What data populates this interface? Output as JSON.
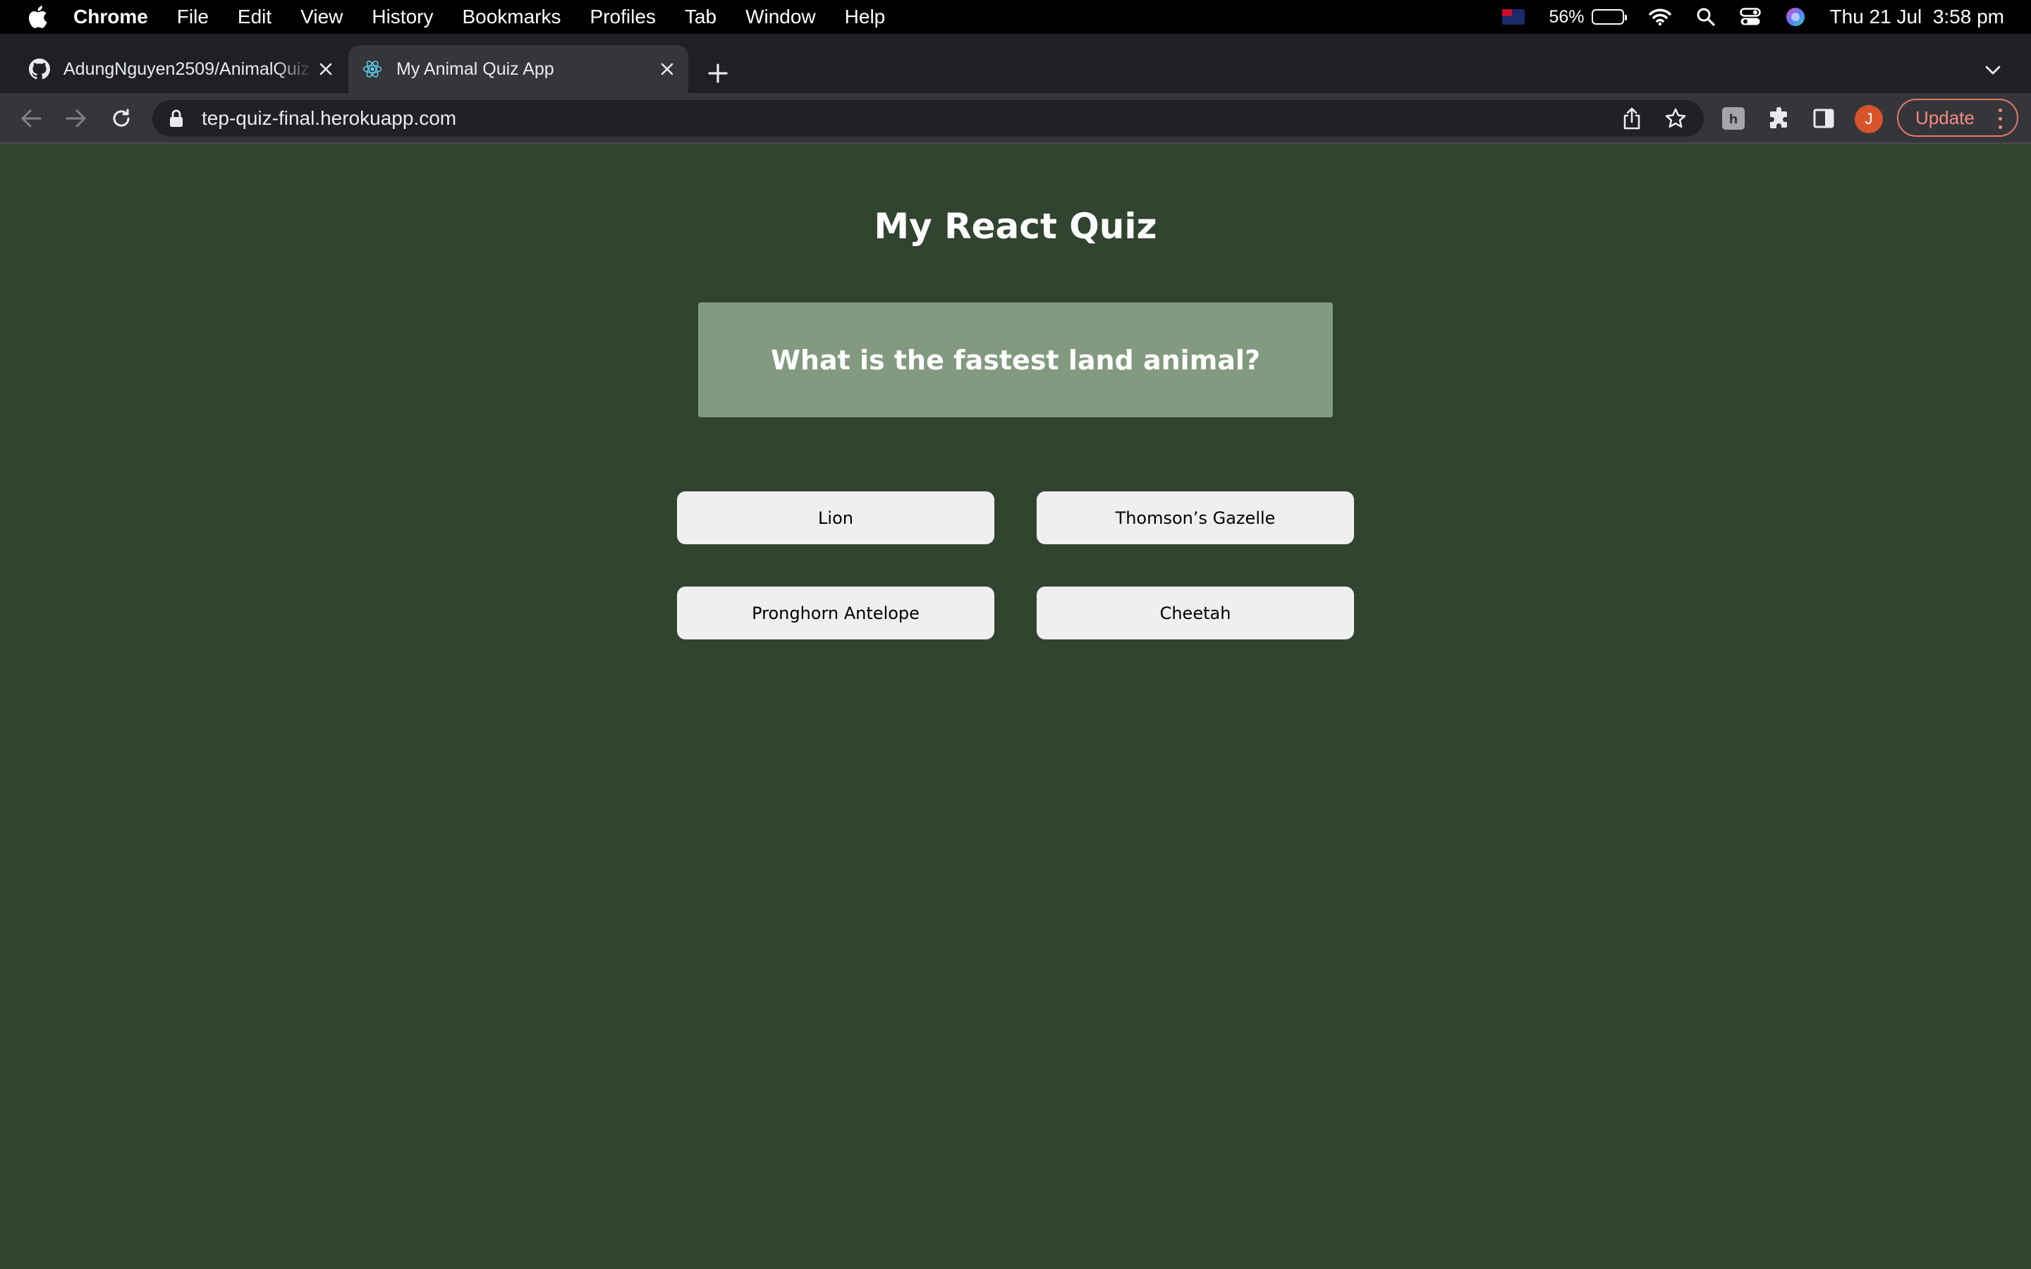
{
  "menubar": {
    "app_name": "Chrome",
    "items": [
      "File",
      "Edit",
      "View",
      "History",
      "Bookmarks",
      "Profiles",
      "Tab",
      "Window",
      "Help"
    ],
    "battery_percent": "56%",
    "battery_level": 0.56,
    "datetime": "Thu 21 Jul  3:58 pm"
  },
  "tabs": [
    {
      "title": "AdungNguyen2509/AnimalQuiz",
      "icon": "github-icon",
      "active": false
    },
    {
      "title": "My Animal Quiz App",
      "icon": "react-icon",
      "active": true
    }
  ],
  "toolbar": {
    "url": "tep-quiz-final.herokuapp.com",
    "profile_initial": "J",
    "update_label": "Update"
  },
  "quiz": {
    "title": "My React Quiz",
    "question": "What is the fastest land animal?",
    "answers": [
      "Lion",
      "Thomson’s Gazelle",
      "Pronghorn Antelope",
      "Cheetah"
    ]
  },
  "colors": {
    "page_background": "#314430",
    "question_card": "#829a7f",
    "answer_button": "#efefef",
    "update_accent": "#f28b82",
    "avatar": "#d8532a"
  }
}
